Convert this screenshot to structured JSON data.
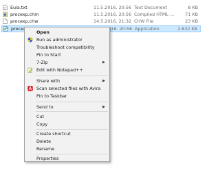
{
  "files": [
    {
      "name": "Eula.txt",
      "date": "11.5.2016. 20:56",
      "type": "Text Document",
      "size": "8 KB",
      "icon": "text-file-icon"
    },
    {
      "name": "procexp.chm",
      "date": "11.5.2016. 20:56",
      "type": "Compiled HTML ...",
      "size": "71 KB",
      "icon": "help-file-icon"
    },
    {
      "name": "procexp.chw",
      "date": "14.5.2016. 21:32",
      "type": "CHW File",
      "size": "23 KB",
      "icon": "generic-file-icon"
    },
    {
      "name": "procexp",
      "date": "11.5.2016. 20:56",
      "type": "Application",
      "size": "2.632 KB",
      "icon": "application-icon"
    }
  ],
  "context_menu": {
    "items": [
      {
        "label": "Open",
        "bold": true
      },
      {
        "label": "Run as administrator",
        "icon": "uac-shield-icon"
      },
      {
        "label": "Troubleshoot compatibility"
      },
      {
        "label": "Pin to Start"
      },
      {
        "label": "7-Zip",
        "submenu": true
      },
      {
        "label": "Edit with Notepad++",
        "icon": "notepad-plus-plus-icon"
      },
      {
        "label": "Share with",
        "submenu": true
      },
      {
        "label": "Scan selected files with Avira",
        "icon": "avira-icon"
      },
      {
        "label": "Pin to Taskbar"
      },
      {
        "label": "Send to",
        "submenu": true
      },
      {
        "label": "Cut"
      },
      {
        "label": "Copy"
      },
      {
        "label": "Create shortcut"
      },
      {
        "label": "Delete"
      },
      {
        "label": "Rename"
      },
      {
        "label": "Properties"
      }
    ]
  },
  "colors": {
    "selection_bg": "#cce8ff",
    "selection_border": "#99d1ff",
    "menu_bg": "#f2f2f2"
  }
}
